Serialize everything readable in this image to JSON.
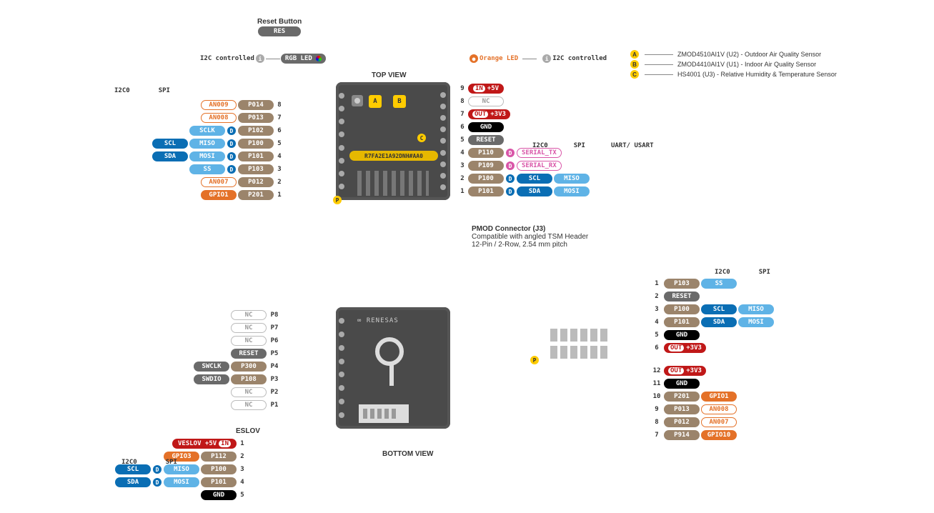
{
  "titles": {
    "reset_button": "Reset Button",
    "res": "RES",
    "i2c_controlled": "I2C controlled",
    "rgb_led": "RGB LED",
    "orange_led": "Orange LED",
    "top_view": "TOP VIEW",
    "bottom_view": "BOTTOM VIEW",
    "bus_i2c0": "I2C0",
    "bus_spi": "SPI",
    "bus_uart": "UART/ USART",
    "pmod_title": "PMOD Connector (J3)",
    "pmod_line2": "Compatible with angled TSM Header",
    "pmod_line3": "12-Pin / 2-Row, 2.54 mm pitch",
    "eslov": "ESLOV",
    "chip": "R7FA2E1A92DNH#AA0",
    "renesas": "RENESAS"
  },
  "sensors": {
    "A": {
      "letter": "A",
      "text": "ZMOD4510AI1V (U2) - Outdoor Air Quality Sensor"
    },
    "B": {
      "letter": "B",
      "text": "ZMOD4410AI1V (U1) - Indoor Air Quality Sensor"
    },
    "C": {
      "letter": "C",
      "text": "HS4001 (U3) - Relative Humidity & Temperature Sensor"
    }
  },
  "top_left_pins": [
    {
      "n": "8",
      "port": "P014",
      "fn": "AN009"
    },
    {
      "n": "7",
      "port": "P013",
      "fn": "AN008"
    },
    {
      "n": "6",
      "port": "P102",
      "spi": "SCLK"
    },
    {
      "n": "5",
      "port": "P100",
      "spi": "MISO",
      "i2c": "SCL"
    },
    {
      "n": "4",
      "port": "P101",
      "spi": "MOSI",
      "i2c": "SDA"
    },
    {
      "n": "3",
      "port": "P103",
      "spi": "SS"
    },
    {
      "n": "2",
      "port": "P012",
      "fn": "AN007"
    },
    {
      "n": "1",
      "port": "P201",
      "gpio": "GPIO1"
    }
  ],
  "top_right_pins": [
    {
      "n": "9",
      "pwr_in": "IN",
      "pwr": "+5V"
    },
    {
      "n": "8",
      "nc": "NC"
    },
    {
      "n": "7",
      "pwr_out": "OUT",
      "pwr": "+3V3"
    },
    {
      "n": "6",
      "gnd": "GND"
    },
    {
      "n": "5",
      "reset": "RESET"
    },
    {
      "n": "4",
      "port": "P110",
      "serial": "SERIAL_TX"
    },
    {
      "n": "3",
      "port": "P109",
      "serial": "SERIAL_RX"
    },
    {
      "n": "2",
      "port": "P100",
      "i2c": "SCL",
      "spi": "MISO"
    },
    {
      "n": "1",
      "port": "P101",
      "i2c": "SDA",
      "spi": "MOSI"
    }
  ],
  "bottom_left_pins": [
    {
      "n": "P8",
      "nc": "NC"
    },
    {
      "n": "P7",
      "nc": "NC"
    },
    {
      "n": "P6",
      "nc": "NC"
    },
    {
      "n": "P5",
      "reset": "RESET"
    },
    {
      "n": "P4",
      "port": "P300",
      "swd": "SWCLK"
    },
    {
      "n": "P3",
      "port": "P108",
      "swd": "SWDIO"
    },
    {
      "n": "P2",
      "nc": "NC"
    },
    {
      "n": "P1",
      "nc": "NC"
    }
  ],
  "eslov_pins": [
    {
      "n": "1",
      "pwr_in": "IN",
      "pwr": "VESLOV +5V"
    },
    {
      "n": "2",
      "port": "P112",
      "gpio": "GPIO3"
    },
    {
      "n": "3",
      "port": "P100",
      "spi": "MISO",
      "i2c": "SCL"
    },
    {
      "n": "4",
      "port": "P101",
      "spi": "MOSI",
      "i2c": "SDA"
    },
    {
      "n": "5",
      "gnd": "GND"
    }
  ],
  "pmod_pins": [
    {
      "n": "1",
      "port": "P103",
      "spi": "SS"
    },
    {
      "n": "2",
      "reset": "RESET"
    },
    {
      "n": "3",
      "port": "P100",
      "i2c": "SCL",
      "spi": "MISO"
    },
    {
      "n": "4",
      "port": "P101",
      "i2c": "SDA",
      "spi": "MOSI"
    },
    {
      "n": "5",
      "gnd": "GND"
    },
    {
      "n": "6",
      "pwr_out": "OUT",
      "pwr": "+3V3"
    },
    {
      "n": "12",
      "pwr_out": "OUT",
      "pwr": "+3V3"
    },
    {
      "n": "11",
      "gnd": "GND"
    },
    {
      "n": "10",
      "port": "P201",
      "gpio": "GPIO1"
    },
    {
      "n": "9",
      "port": "P013",
      "fn": "AN008"
    },
    {
      "n": "8",
      "port": "P012",
      "fn": "AN007"
    },
    {
      "n": "7",
      "port": "P914",
      "gpio": "GPIO10"
    }
  ],
  "badges": {
    "D": "D",
    "P": "P",
    "i": "i"
  }
}
